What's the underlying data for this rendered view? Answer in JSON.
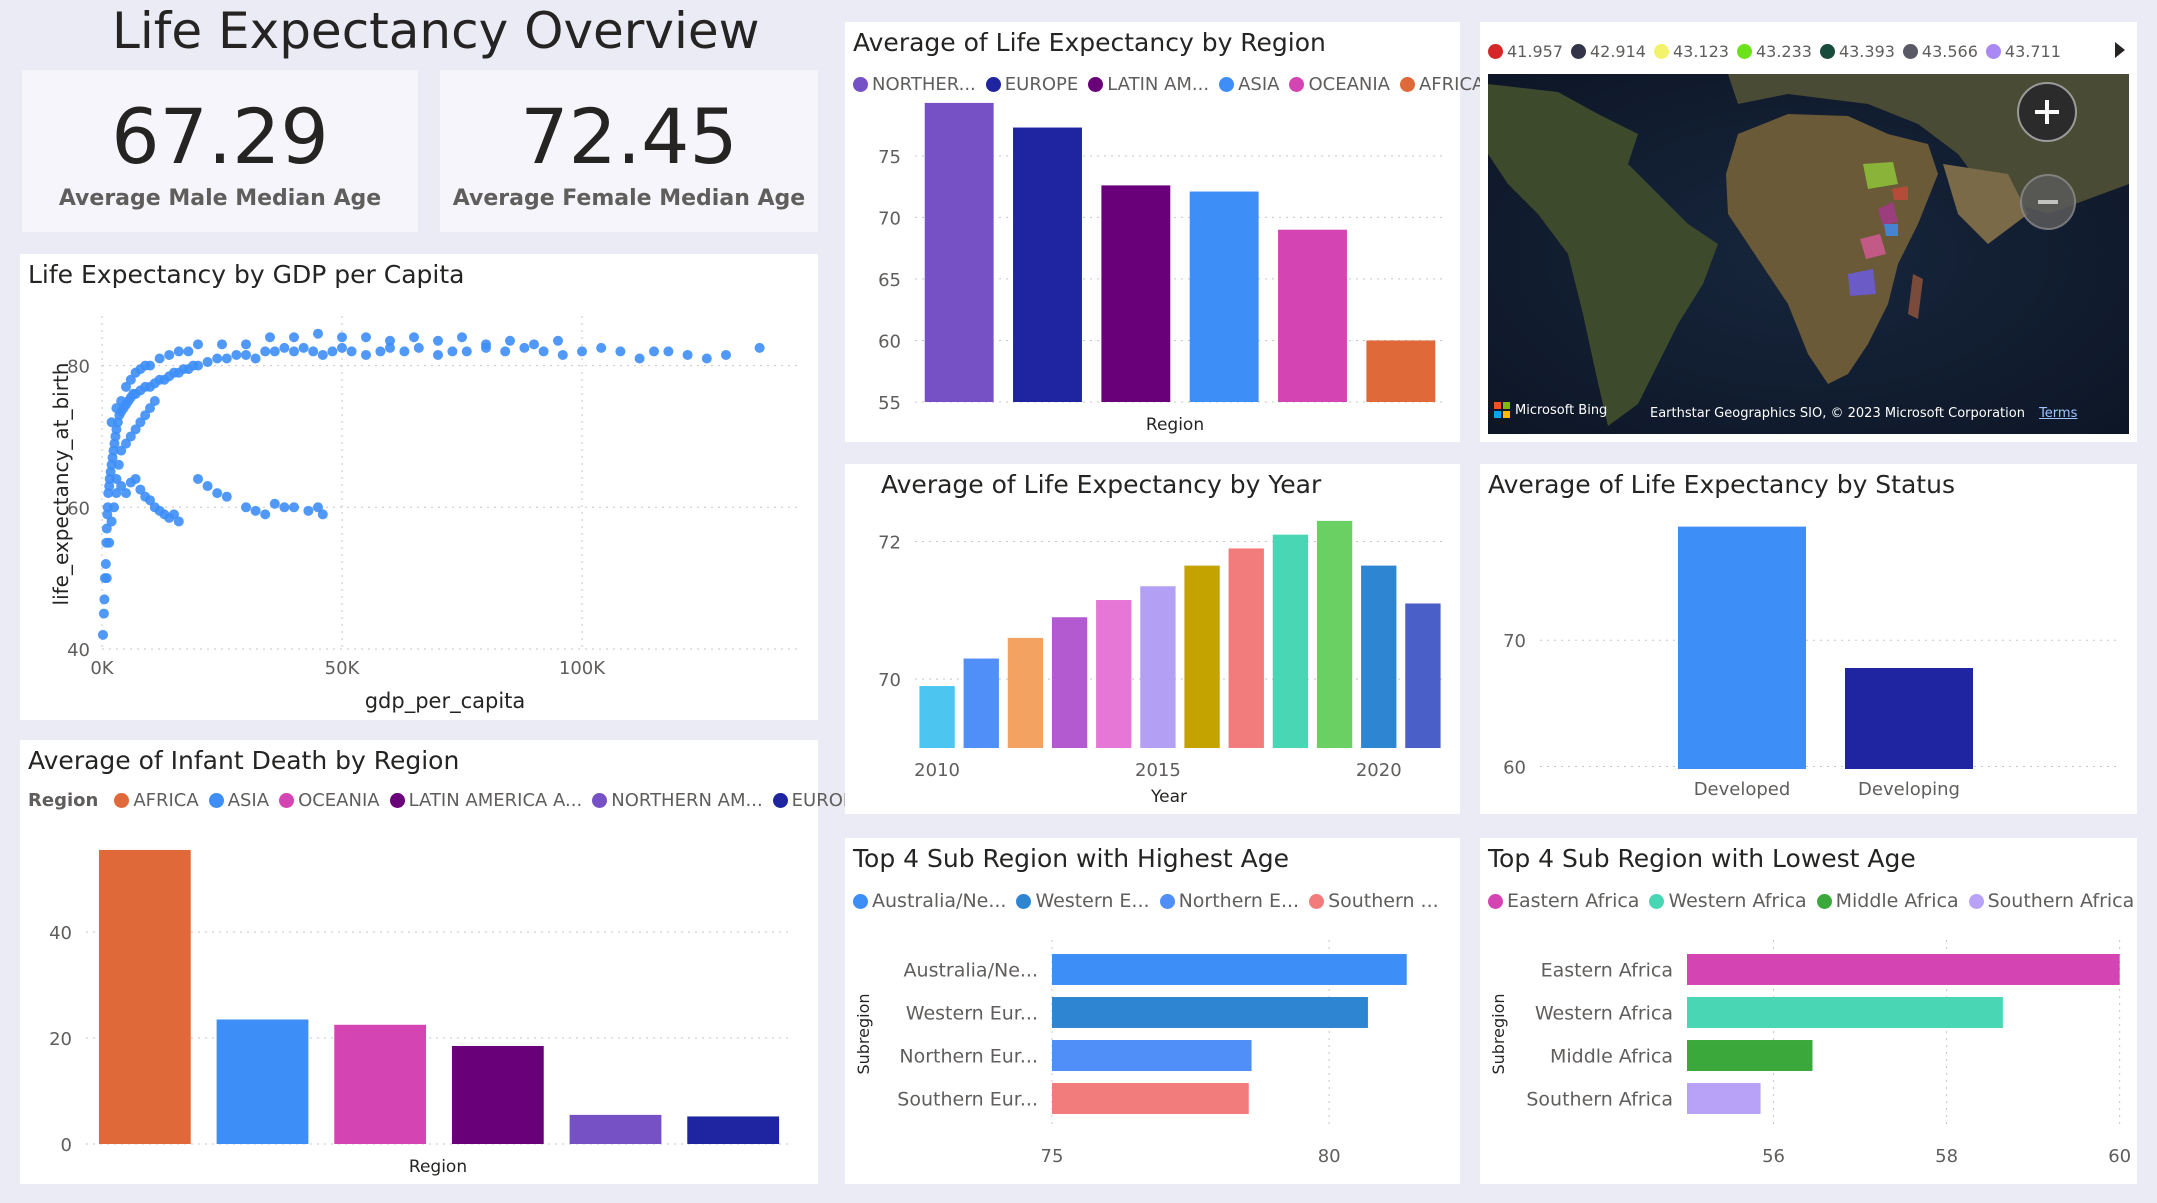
{
  "page_title": "Life Expectancy Overview",
  "kpis": [
    {
      "value": "67.29",
      "label": "Average Male Median Age"
    },
    {
      "value": "72.45",
      "label": "Average Female Median Age"
    }
  ],
  "map": {
    "legend": [
      {
        "label": "41.957",
        "color": "#d62728"
      },
      {
        "label": "42.914",
        "color": "#33334a"
      },
      {
        "label": "43.123",
        "color": "#f3f36a"
      },
      {
        "label": "43.233",
        "color": "#6de11a"
      },
      {
        "label": "43.393",
        "color": "#174c3c"
      },
      {
        "label": "43.566",
        "color": "#5a5a66"
      },
      {
        "label": "43.711",
        "color": "#a88af2"
      }
    ],
    "bing_label": "Microsoft Bing",
    "attribution": "Earthstar Geographics SIO, © 2023 Microsoft Corporation",
    "terms_label": "Terms",
    "zoom_in_icon": "plus-icon",
    "zoom_out_icon": "minus-icon"
  },
  "charts": {
    "scatter": {
      "title": "Life Expectancy by GDP per Capita",
      "xlabel": "gdp_per_capita",
      "ylabel": "life_expectancy_at_birth",
      "xticks": [
        "0K",
        "50K",
        "100K"
      ],
      "yticks": [
        "40",
        "60",
        "80"
      ]
    },
    "region": {
      "title": "Average of Life Expectancy by Region",
      "xlabel": "Region",
      "yticks": [
        "55",
        "60",
        "65",
        "70",
        "75"
      ],
      "legend": [
        {
          "label": "NORTHER...",
          "color": "#7650c5"
        },
        {
          "label": "EUROPE",
          "color": "#1f24a0"
        },
        {
          "label": "LATIN AM...",
          "color": "#6a0079"
        },
        {
          "label": "ASIA",
          "color": "#3d8ef7"
        },
        {
          "label": "OCEANIA",
          "color": "#d444b2"
        },
        {
          "label": "AFRICA",
          "color": "#e0693a"
        }
      ]
    },
    "infant": {
      "title": "Average of Infant Death by Region",
      "xlabel": "Region",
      "legend_title": "Region",
      "yticks": [
        "0",
        "20",
        "40"
      ],
      "legend": [
        {
          "label": "AFRICA",
          "color": "#e0693a"
        },
        {
          "label": "ASIA",
          "color": "#3d8ef7"
        },
        {
          "label": "OCEANIA",
          "color": "#d444b2"
        },
        {
          "label": "LATIN AMERICA A...",
          "color": "#6a0079"
        },
        {
          "label": "NORTHERN AM...",
          "color": "#7650c5"
        },
        {
          "label": "EUROPE",
          "color": "#1f24a0"
        }
      ]
    },
    "year": {
      "title": "Average of Life Expectancy by Year",
      "xlabel": "Year",
      "xticks": [
        "2010",
        "2015",
        "2020"
      ],
      "yticks": [
        "70",
        "72"
      ]
    },
    "status": {
      "title": "Average of Life Expectancy by Status",
      "categories": [
        "Developed",
        "Developing"
      ],
      "yticks": [
        "60",
        "70"
      ]
    },
    "top_high": {
      "title": "Top 4 Sub Region with Highest Age",
      "ylabel": "Subregion",
      "categories": [
        "Australia/Ne...",
        "Western Eur...",
        "Northern Eur...",
        "Southern Eur..."
      ],
      "xticks": [
        "75",
        "80"
      ],
      "legend": [
        {
          "label": "Australia/Ne...",
          "color": "#3d8ef7"
        },
        {
          "label": "Western E...",
          "color": "#2e86d3"
        },
        {
          "label": "Northern E...",
          "color": "#4f8ff7"
        },
        {
          "label": "Southern ...",
          "color": "#f27c7c"
        }
      ]
    },
    "top_low": {
      "title": "Top 4 Sub Region with Lowest Age",
      "ylabel": "Subregion",
      "categories": [
        "Eastern Africa",
        "Western Africa",
        "Middle Africa",
        "Southern Africa"
      ],
      "xticks": [
        "56",
        "58",
        "60"
      ],
      "legend": [
        {
          "label": "Eastern Africa",
          "color": "#d444b2"
        },
        {
          "label": "Western Africa",
          "color": "#49d6b4"
        },
        {
          "label": "Middle Africa",
          "color": "#3aa83a"
        },
        {
          "label": "Southern Africa",
          "color": "#b8a2f7"
        }
      ]
    }
  },
  "chart_data": [
    {
      "type": "scatter",
      "title": "Life Expectancy by GDP per Capita",
      "xlabel": "gdp_per_capita",
      "ylabel": "life_expectancy_at_birth",
      "xlim": [
        0,
        145000
      ],
      "ylim": [
        40,
        87
      ],
      "grid": true,
      "color": "#3d8ef7",
      "points": [
        [
          200,
          42
        ],
        [
          400,
          45
        ],
        [
          500,
          47
        ],
        [
          600,
          50
        ],
        [
          800,
          52
        ],
        [
          900,
          55
        ],
        [
          1000,
          57
        ],
        [
          1100,
          59
        ],
        [
          1200,
          60
        ],
        [
          1300,
          62
        ],
        [
          1500,
          63
        ],
        [
          1600,
          64
        ],
        [
          1800,
          65
        ],
        [
          2000,
          66
        ],
        [
          2200,
          67
        ],
        [
          2400,
          68
        ],
        [
          2600,
          69
        ],
        [
          2800,
          70
        ],
        [
          3000,
          71
        ],
        [
          3300,
          72
        ],
        [
          3600,
          73
        ],
        [
          4000,
          73.5
        ],
        [
          4500,
          74
        ],
        [
          5000,
          74.5
        ],
        [
          5500,
          75
        ],
        [
          6000,
          75.5
        ],
        [
          6500,
          76
        ],
        [
          7000,
          76
        ],
        [
          8000,
          76.5
        ],
        [
          9000,
          77
        ],
        [
          10000,
          77
        ],
        [
          11000,
          77.5
        ],
        [
          12000,
          78
        ],
        [
          13000,
          78
        ],
        [
          14000,
          78.5
        ],
        [
          15000,
          79
        ],
        [
          16000,
          79
        ],
        [
          17000,
          79.5
        ],
        [
          18000,
          79.5
        ],
        [
          19000,
          80
        ],
        [
          20000,
          80
        ],
        [
          22000,
          80.5
        ],
        [
          24000,
          81
        ],
        [
          26000,
          81
        ],
        [
          28000,
          81.5
        ],
        [
          30000,
          81.5
        ],
        [
          32000,
          81
        ],
        [
          34000,
          82
        ],
        [
          36000,
          82
        ],
        [
          38000,
          82.5
        ],
        [
          40000,
          82
        ],
        [
          42000,
          82.5
        ],
        [
          44000,
          82
        ],
        [
          46000,
          81.5
        ],
        [
          48000,
          82
        ],
        [
          50000,
          82.5
        ],
        [
          52000,
          82
        ],
        [
          55000,
          81.5
        ],
        [
          58000,
          82
        ],
        [
          60000,
          82.5
        ],
        [
          63000,
          82
        ],
        [
          66000,
          82.5
        ],
        [
          70000,
          81.5
        ],
        [
          73000,
          82
        ],
        [
          76000,
          82
        ],
        [
          80000,
          82.5
        ],
        [
          84000,
          82
        ],
        [
          88000,
          82.5
        ],
        [
          92000,
          82
        ],
        [
          96000,
          81.5
        ],
        [
          100000,
          82
        ],
        [
          104000,
          82.5
        ],
        [
          108000,
          82
        ],
        [
          112000,
          81
        ],
        [
          115000,
          82
        ],
        [
          118000,
          82
        ],
        [
          122000,
          81.5
        ],
        [
          126000,
          81
        ],
        [
          130000,
          81.5
        ],
        [
          137000,
          82.5
        ],
        [
          3000,
          64
        ],
        [
          4000,
          63
        ],
        [
          5000,
          62
        ],
        [
          6000,
          63.5
        ],
        [
          7000,
          64
        ],
        [
          8000,
          62.5
        ],
        [
          9000,
          61.5
        ],
        [
          10000,
          61
        ],
        [
          11000,
          60
        ],
        [
          12000,
          59.5
        ],
        [
          13000,
          59
        ],
        [
          14000,
          58.5
        ],
        [
          15000,
          59
        ],
        [
          16000,
          58
        ],
        [
          20000,
          64
        ],
        [
          22000,
          63
        ],
        [
          24000,
          62
        ],
        [
          26000,
          61.5
        ],
        [
          30000,
          60
        ],
        [
          32000,
          59.5
        ],
        [
          34000,
          59
        ],
        [
          36000,
          60.5
        ],
        [
          38000,
          60
        ],
        [
          40000,
          60
        ],
        [
          43000,
          59.5
        ],
        [
          45000,
          60
        ],
        [
          46000,
          59
        ],
        [
          2000,
          72
        ],
        [
          3000,
          74
        ],
        [
          4000,
          75
        ],
        [
          5000,
          77
        ],
        [
          6000,
          78
        ],
        [
          7000,
          79
        ],
        [
          8000,
          79.5
        ],
        [
          9000,
          80
        ],
        [
          10000,
          80
        ],
        [
          12000,
          81
        ],
        [
          14000,
          81.5
        ],
        [
          16000,
          82
        ],
        [
          18000,
          82
        ],
        [
          20000,
          83
        ],
        [
          25000,
          83
        ],
        [
          30000,
          83
        ],
        [
          35000,
          84
        ],
        [
          40000,
          84
        ],
        [
          45000,
          84.5
        ],
        [
          50000,
          84
        ],
        [
          55000,
          84
        ],
        [
          60000,
          83.5
        ],
        [
          65000,
          84
        ],
        [
          70000,
          83.5
        ],
        [
          75000,
          84
        ],
        [
          80000,
          83
        ],
        [
          85000,
          83.5
        ],
        [
          90000,
          83
        ],
        [
          95000,
          83.5
        ],
        [
          1000,
          50
        ],
        [
          1500,
          55
        ],
        [
          2000,
          58
        ],
        [
          2500,
          60
        ],
        [
          3000,
          62
        ],
        [
          3500,
          66
        ],
        [
          4000,
          68
        ],
        [
          5000,
          69
        ],
        [
          6000,
          70
        ],
        [
          7000,
          71
        ],
        [
          8000,
          72
        ],
        [
          9000,
          73
        ],
        [
          10000,
          74
        ],
        [
          11000,
          75
        ]
      ]
    },
    {
      "type": "bar",
      "title": "Average of Life Expectancy by Region",
      "xlabel": "Region",
      "categories": [
        "NORTHERN AMERICA",
        "EUROPE",
        "LATIN AMERICA",
        "ASIA",
        "OCEANIA",
        "AFRICA"
      ],
      "values": [
        79.3,
        77.3,
        72.6,
        72.1,
        69.0,
        60.0
      ],
      "colors": [
        "#7650c5",
        "#1f24a0",
        "#6a0079",
        "#3d8ef7",
        "#d444b2",
        "#e0693a"
      ],
      "ylim": [
        55,
        81
      ],
      "grid": true
    },
    {
      "type": "bar",
      "title": "Average of Infant Death by Region",
      "xlabel": "Region",
      "categories": [
        "AFRICA",
        "ASIA",
        "OCEANIA",
        "LATIN AMERICA",
        "NORTHERN AMERICA",
        "EUROPE"
      ],
      "values": [
        55.5,
        23.5,
        22.5,
        18.5,
        5.5,
        5.2
      ],
      "colors": [
        "#e0693a",
        "#3d8ef7",
        "#d444b2",
        "#6a0079",
        "#7650c5",
        "#1f24a0"
      ],
      "ylim": [
        0,
        57
      ],
      "grid": true
    },
    {
      "type": "bar",
      "title": "Average of Life Expectancy by Year",
      "xlabel": "Year",
      "categories": [
        2010,
        2011,
        2012,
        2013,
        2014,
        2015,
        2016,
        2017,
        2018,
        2019,
        2020,
        2021
      ],
      "values": [
        69.9,
        70.3,
        70.6,
        70.9,
        71.15,
        71.35,
        71.65,
        71.9,
        72.1,
        72.3,
        71.65,
        71.1
      ],
      "colors": [
        "#4cc6f0",
        "#4f8ff7",
        "#f4a261",
        "#b45ad0",
        "#e777d6",
        "#b3a0f5",
        "#c4a200",
        "#f27c7c",
        "#49d6b4",
        "#6ad064",
        "#2e86d3",
        "#4a5fc8"
      ],
      "ylim": [
        69,
        72.4
      ],
      "grid": true
    },
    {
      "type": "bar",
      "title": "Average of Life Expectancy by Status",
      "categories": [
        "Developed",
        "Developing"
      ],
      "values": [
        79.0,
        67.8
      ],
      "colors": [
        "#3d8ef7",
        "#1f24a0"
      ],
      "ylim": [
        59.8,
        80
      ],
      "grid": true
    },
    {
      "type": "bar",
      "orientation": "horizontal",
      "title": "Top 4 Sub Region with Highest Age",
      "ylabel": "Subregion",
      "categories": [
        "Australia/Ne...",
        "Western Eur...",
        "Northern Eur...",
        "Southern Eur..."
      ],
      "values": [
        81.4,
        80.7,
        78.6,
        78.55
      ],
      "colors": [
        "#3d8ef7",
        "#2e86d3",
        "#4f8ff7",
        "#f27c7c"
      ],
      "xlim": [
        75,
        82
      ],
      "grid": true
    },
    {
      "type": "bar",
      "orientation": "horizontal",
      "title": "Top 4 Sub Region with Lowest Age",
      "ylabel": "Subregion",
      "categories": [
        "Eastern Africa",
        "Western Africa",
        "Middle Africa",
        "Southern Africa"
      ],
      "values": [
        60.0,
        58.65,
        56.45,
        55.85
      ],
      "colors": [
        "#d444b2",
        "#49d6b4",
        "#3aa83a",
        "#b8a2f7"
      ],
      "xlim": [
        55,
        60.05
      ],
      "grid": true
    }
  ]
}
